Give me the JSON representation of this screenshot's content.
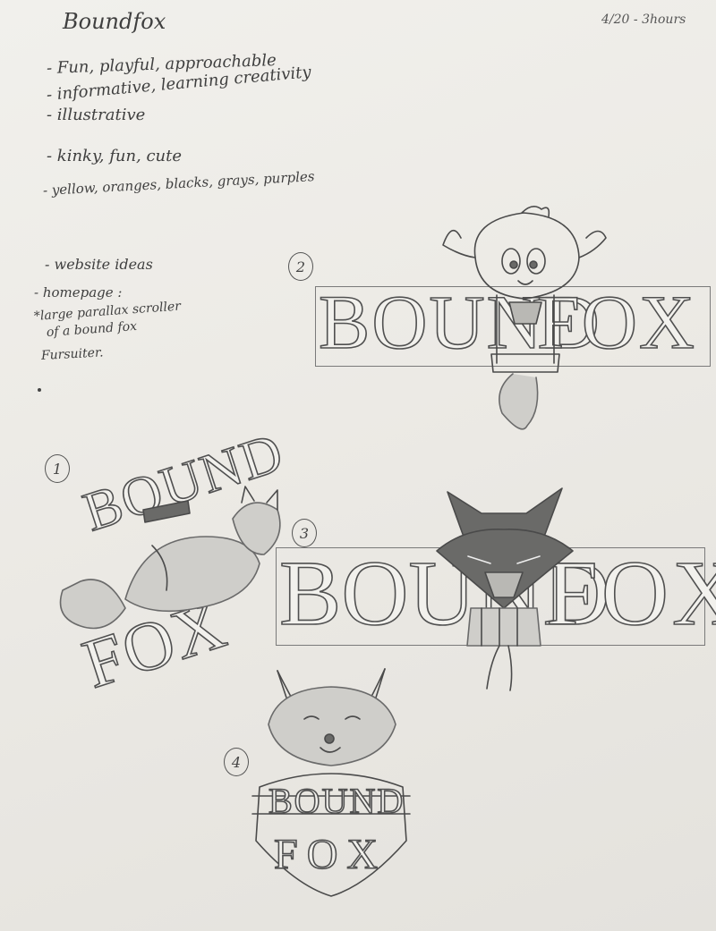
{
  "header": {
    "title": "Boundfox",
    "date": "4/20 - 3hours"
  },
  "notes": [
    "- Fun, playful, approachable",
    "- informative, learning creativity",
    "- illustrative",
    "- kinky, fun, cute",
    "- yellow, oranges, blacks, grays, purples"
  ],
  "website": {
    "heading": "- website ideas",
    "items": [
      "- homepage :",
      "*large parallax scroller",
      "of a bound fox",
      "Fursuiter."
    ]
  },
  "sketches": [
    {
      "number": "2",
      "word_left": "BOUND",
      "word_right": "FOX"
    },
    {
      "number": "1",
      "word_left": "BOUND",
      "word_right": "FOX"
    },
    {
      "number": "3",
      "word_left": "BOUND",
      "word_right": "FOX"
    },
    {
      "number": "4",
      "word_left": "BOUND",
      "word_right": "FOX"
    }
  ]
}
